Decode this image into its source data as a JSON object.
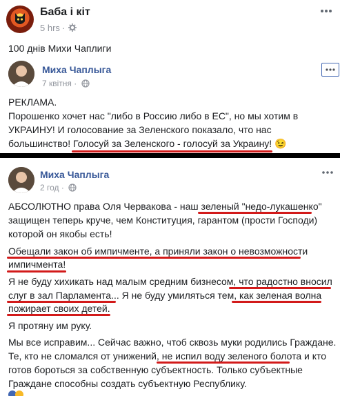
{
  "outer_post": {
    "page_name": "Баба і кіт",
    "time": "5 hrs",
    "separator": "·",
    "text": "100 днів Михи Чаплиги"
  },
  "screenshot_1": {
    "author": "Миха Чаплыга",
    "date": "7 квітня",
    "separator": "·",
    "lines": [
      "РЕКЛАМА.",
      "Порошенко хочет нас \"либо в Россию либо в ЕС\", но мы хотим в",
      "УКРАИНУ! И голосование за Зеленского показало, что нас",
      "большинство! Голосуй за Зеленского - голосуй за Украину! 😉"
    ]
  },
  "screenshot_2": {
    "author": "Миха Чаплыга",
    "date": "2 год",
    "separator": "·",
    "lines": [
      "АБСОЛЮТНО права Оля Червакова - наш зеленый \"недо-лукашенко\"",
      "защищен теперь круче, чем Конституция, гарантом (прости Господи)",
      "которой он якобы есть!",
      "Обещали закон об импичменте, а приняли закон о невозможности",
      "импичмента!",
      "Я не буду хихикать над малым средним бизнесом, что радостно вносил",
      "слуг в зал Парламента... Я не буду умиляться тем, как зеленая волна",
      "пожирает своих детей.",
      "Я протяну им руку.",
      "Мы все исправим... Сейчас важно, чтоб сквозь муки родились Граждане.",
      "Те, кто не сломался от унижений, не испил воду зеленого болота и кто",
      "готов бороться за собственную субъектность. Только субъектные",
      "Граждане способны создать субъектную Республику."
    ]
  },
  "colors": {
    "underline": "#d21a1a",
    "author_link": "#385898",
    "meta_gray": "#90949c",
    "divider": "#000000"
  },
  "icons": [
    "cat-avatar-icon",
    "gear-icon",
    "more-icon",
    "globe-icon"
  ]
}
